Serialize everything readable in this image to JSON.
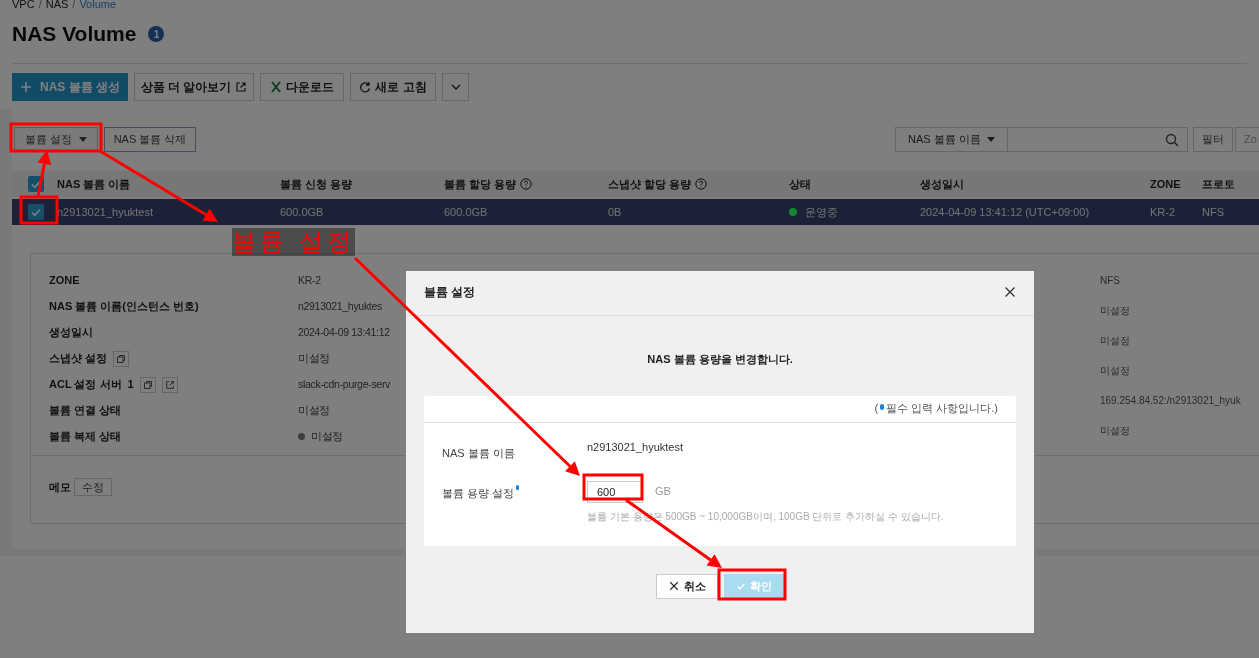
{
  "breadcrumb": {
    "items": [
      "VPC",
      "NAS",
      "Volume"
    ],
    "separator": "/"
  },
  "page": {
    "title": "NAS Volume",
    "count": "1"
  },
  "actions": [
    {
      "kind": "primary",
      "label": "NAS 볼륨 생성"
    },
    {
      "kind": "external",
      "label": "상품 더 알아보기"
    },
    {
      "kind": "excel",
      "label": "다운로드"
    },
    {
      "kind": "refresh",
      "label": "새로 고침"
    },
    {
      "kind": "more"
    }
  ],
  "toolbar": {
    "volume_menu": "볼륨 설정",
    "delete": "NAS 볼륨 삭제",
    "search_by": "NAS 볼륨 이름",
    "filter": "필터",
    "zone": "Zo"
  },
  "table": {
    "all_checked": true,
    "columns": [
      {
        "label": "NAS 볼륨 이름",
        "help": false
      },
      {
        "label": "볼륨 신청 용량",
        "help": false
      },
      {
        "label": "볼륨 할당 용량",
        "help": true
      },
      {
        "label": "스냅샷 할당 용량",
        "help": true
      },
      {
        "label": "상태",
        "help": false
      },
      {
        "label": "생성일시",
        "help": false
      },
      {
        "label": "ZONE",
        "help": false
      },
      {
        "label": "프로토",
        "help": false
      }
    ],
    "rows": [
      {
        "checked": true,
        "selected": true,
        "name": "n2913021_hyuktest",
        "requested": "600.0GB",
        "allocated": "600.0GB",
        "snapshot": "0B",
        "status": {
          "label": "운영중",
          "color": "#12882e"
        },
        "created": "2024-04-09 13:41:12 (UTC+09:00)",
        "zone": "KR-2",
        "protocol": "NFS"
      }
    ]
  },
  "details": {
    "left": [
      {
        "label": "ZONE",
        "value": "KR-2"
      },
      {
        "label": "NAS 볼륨 이름(인스턴스 번호)",
        "value": "n2913021_hyuktes"
      },
      {
        "label": "생성일시",
        "value": "2024-04-09 13:41:12"
      },
      {
        "label": "스냅샷 설정",
        "value": "미설정",
        "icons": [
          {
            "kind": "copy"
          }
        ]
      },
      {
        "label": "ACL 설정 서버",
        "count": "1",
        "value": "slack-cdn-purge-serv",
        "icons": [
          {
            "kind": "copy"
          },
          {
            "kind": "external"
          }
        ]
      },
      {
        "label": "볼륨 연결 상태",
        "value": "미설정"
      },
      {
        "label": "볼륨 복제 상태",
        "value": "미설정",
        "color": "#3f3f3f"
      }
    ],
    "right": [
      "NFS",
      "미설정",
      "미설정",
      "미설정",
      "169.254.84.52:/n2913021_hyuk",
      "미설정"
    ],
    "memo": {
      "label": "메모",
      "button": "수정"
    }
  },
  "modal": {
    "title": "볼륨 설정",
    "message": "NAS 볼륨 용량을 변경합니다.",
    "note_open": "(",
    "note": "필수 입력 사항입니다.)",
    "fields": [
      {
        "kind": "text",
        "label": "NAS 볼륨 이름",
        "required": false,
        "value": "n2913021_hyuktest"
      },
      {
        "kind": "input",
        "label": "볼륨 용량 설정",
        "required": true,
        "value": "600",
        "unit": "GB",
        "help": "볼륨 기본 용량은 500GB ~ 10,000GB이며, 100GB 단위로 추가하실 수 있습니다."
      }
    ],
    "buttons": [
      {
        "kind": "cancel",
        "label": "취소",
        "disabled": false
      },
      {
        "kind": "confirm",
        "label": "확인",
        "disabled": true
      }
    ]
  },
  "annotation": {
    "caption": "볼륨 설정"
  }
}
